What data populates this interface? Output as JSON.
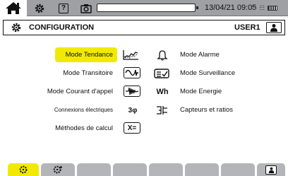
{
  "statusbar": {
    "icons": [
      "home-icon",
      "gear-icon",
      "help-icon",
      "camera-icon",
      "battery-gauge",
      "usb-icon",
      "network-icon",
      "battery-icon"
    ],
    "datetime": "13/04/21 09:05",
    "help_label": "?"
  },
  "header": {
    "title": "CONFIGURATION",
    "user": "USER1"
  },
  "menu": {
    "left": [
      {
        "label": "Mode Tendance",
        "icon": "trend-icon",
        "selected": true
      },
      {
        "label": "Mode Transitoire",
        "icon": "transient-icon",
        "selected": false
      },
      {
        "label": "Mode Courant d'appel",
        "icon": "inrush-icon",
        "selected": false
      },
      {
        "label": "Connexions électriques",
        "icon": "three-phase-icon",
        "icon_text": "3φ",
        "selected": false
      },
      {
        "label": "Méthodes de calcul",
        "icon": "calculation-icon",
        "icon_text": "X=",
        "selected": false
      }
    ],
    "right": [
      {
        "label": "Mode Alarme",
        "icon": "bell-icon"
      },
      {
        "label": "Mode Surveillance",
        "icon": "monitoring-icon"
      },
      {
        "label": "Mode Energie",
        "icon": "energy-icon",
        "icon_text": "Wh"
      },
      {
        "label": "Capteurs et ratios",
        "icon": "sensor-icon"
      }
    ]
  },
  "tabs": [
    {
      "name": "config-tab",
      "icon": "gear-icon",
      "active": true
    },
    {
      "name": "advanced-config-tab",
      "icon": "gear-plus-icon",
      "active": false
    },
    {
      "name": "empty-tab-3",
      "active": false
    },
    {
      "name": "empty-tab-4",
      "active": false
    },
    {
      "name": "empty-tab-5",
      "active": false
    },
    {
      "name": "empty-tab-6",
      "active": false
    },
    {
      "name": "empty-tab-7",
      "active": false
    },
    {
      "name": "user-tab",
      "icon": "user-icon",
      "active": false
    }
  ],
  "colors": {
    "accent": "#f1ea00",
    "statusbar": "#9ea0a3",
    "tab": "#b3b5b8"
  }
}
